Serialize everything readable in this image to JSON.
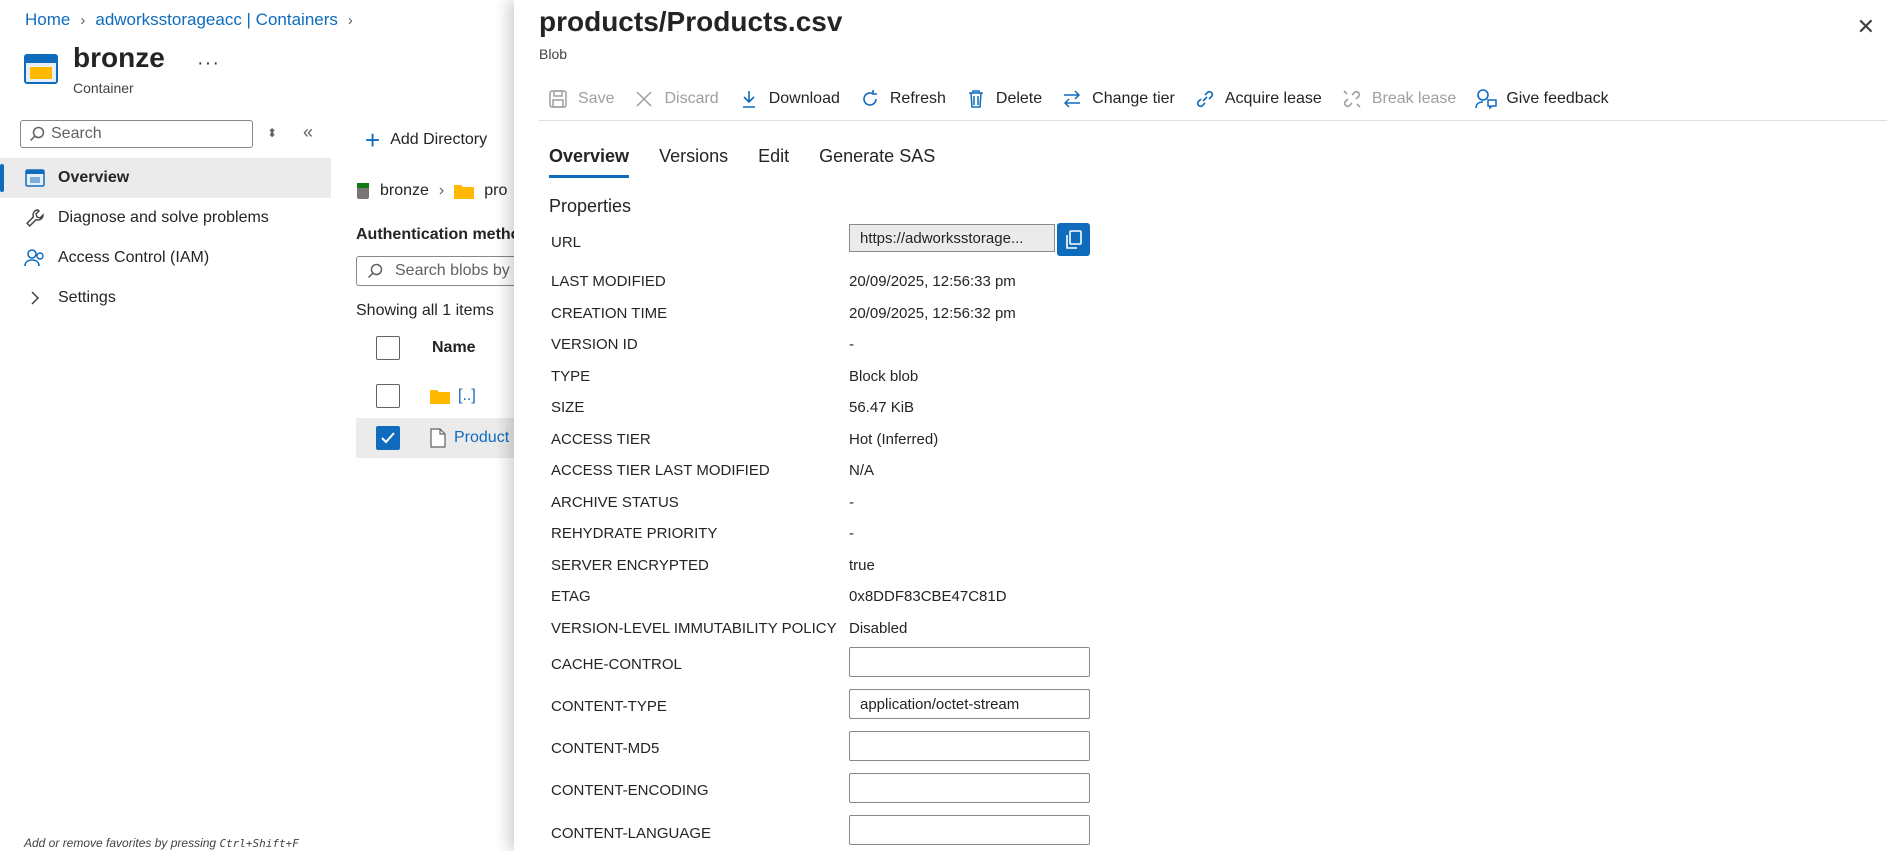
{
  "breadcrumb": {
    "home": "Home",
    "containers": "adworksstorageacc | Containers"
  },
  "resource": {
    "title": "bronze",
    "subtitle": "Container",
    "more": "···"
  },
  "left_search": {
    "placeholder": "Search"
  },
  "nav": {
    "overview": "Overview",
    "diagnose": "Diagnose and solve problems",
    "iam": "Access Control (IAM)",
    "settings": "Settings"
  },
  "footer_hint": {
    "text": "Add or remove favorites by pressing",
    "shortcut": "Ctrl+Shift+F"
  },
  "container_view": {
    "add_directory": "Add Directory",
    "path_root": "bronze",
    "path_folder": "pro",
    "auth_label": "Authentication metho",
    "search_placeholder": "Search blobs by",
    "showing": "Showing all 1 items",
    "col_name": "Name",
    "parent_item": "[..]",
    "file_item": "Product"
  },
  "blade": {
    "title": "products/Products.csv",
    "subtitle": "Blob",
    "close": "✕",
    "toolbar": {
      "save": "Save",
      "discard": "Discard",
      "download": "Download",
      "refresh": "Refresh",
      "delete": "Delete",
      "change_tier": "Change tier",
      "acquire_lease": "Acquire lease",
      "break_lease": "Break lease",
      "give_feedback": "Give feedback"
    },
    "tabs": {
      "overview": "Overview",
      "versions": "Versions",
      "edit": "Edit",
      "sas": "Generate SAS"
    },
    "properties_heading": "Properties",
    "labels": {
      "url": "URL",
      "last_modified": "LAST MODIFIED",
      "creation_time": "CREATION TIME",
      "version_id": "VERSION ID",
      "type": "TYPE",
      "size": "SIZE",
      "access_tier": "ACCESS TIER",
      "access_tier_last_modified": "ACCESS TIER LAST MODIFIED",
      "archive_status": "ARCHIVE STATUS",
      "rehydrate_priority": "REHYDRATE PRIORITY",
      "server_encrypted": "SERVER ENCRYPTED",
      "etag": "ETAG",
      "immutability": "VERSION-LEVEL IMMUTABILITY POLICY",
      "cache_control": "CACHE-CONTROL",
      "content_type": "CONTENT-TYPE",
      "content_md5": "CONTENT-MD5",
      "content_encoding": "CONTENT-ENCODING",
      "content_language": "CONTENT-LANGUAGE"
    },
    "values": {
      "url": "https://adworksstorage...",
      "last_modified": "20/09/2025, 12:56:33 pm",
      "creation_time": "20/09/2025, 12:56:32 pm",
      "version_id": "-",
      "type": "Block blob",
      "size": "56.47 KiB",
      "access_tier": "Hot (Inferred)",
      "access_tier_last_modified": "N/A",
      "archive_status": "-",
      "rehydrate_priority": "-",
      "server_encrypted": "true",
      "etag": "0x8DDF83CBE47C81D",
      "immutability": "Disabled",
      "cache_control": "",
      "content_type": "application/octet-stream",
      "content_md5": "",
      "content_encoding": "",
      "content_language": ""
    }
  },
  "colors": {
    "accent": "#0f6cbd",
    "folder": "#ffb900",
    "selected_row": "#ebebeb",
    "disabled": "#a19f9d"
  }
}
